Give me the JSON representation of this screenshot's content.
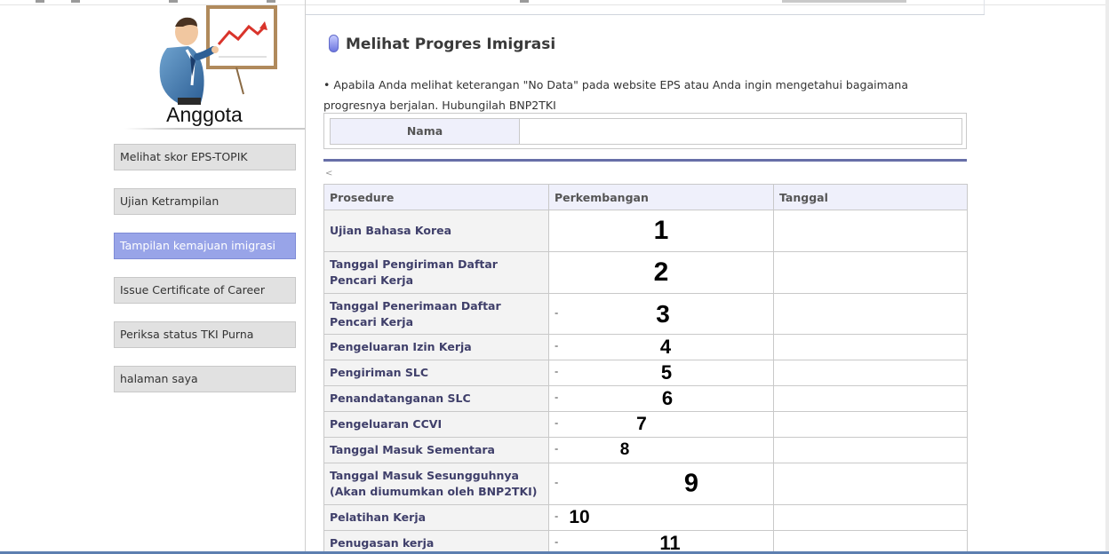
{
  "sidebar": {
    "title": "Anggota",
    "items": [
      {
        "label": "Melihat skor EPS-TOPIK",
        "active": false
      },
      {
        "label": "Ujian Ketrampilan",
        "active": false
      },
      {
        "label": "Tampilan kemajuan imigrasi",
        "active": true
      },
      {
        "label": "Issue Certificate of Career",
        "active": false
      },
      {
        "label": "Periksa status TKI Purna",
        "active": false
      },
      {
        "label": "halaman saya",
        "active": false
      }
    ]
  },
  "page": {
    "title": "Melihat Progres Imigrasi",
    "note": "• Apabila Anda melihat keterangan \"No Data\" pada website EPS atau Anda ingin mengetahui bagaimana progresnya berjalan. Hubungilah BNP2TKI",
    "name_label": "Nama",
    "small_mark": "<"
  },
  "table": {
    "headers": [
      "Prosedure",
      "Perkembangan",
      "Tanggal"
    ],
    "rows": [
      {
        "procedure": "Ujian Bahasa Korea",
        "dash": "",
        "marker": "1"
      },
      {
        "procedure": "Tanggal Pengiriman Daftar Pencari Kerja",
        "dash": "",
        "marker": "2"
      },
      {
        "procedure": "Tanggal Penerimaan Daftar Pencari Kerja",
        "dash": "-",
        "marker": "3"
      },
      {
        "procedure": "Pengeluaran Izin Kerja",
        "dash": "-",
        "marker": "4"
      },
      {
        "procedure": "Pengiriman SLC",
        "dash": "-",
        "marker": "5"
      },
      {
        "procedure": "Penandatanganan SLC",
        "dash": "-",
        "marker": "6"
      },
      {
        "procedure": "Pengeluaran CCVI",
        "dash": "-",
        "marker": "7"
      },
      {
        "procedure": "Tanggal Masuk Sementara",
        "dash": "-",
        "marker": "8"
      },
      {
        "procedure": "Tanggal Masuk Sesungguhnya (Akan diumumkan oleh BNP2TKI)",
        "dash": "-",
        "marker": "9"
      },
      {
        "procedure": "Pelatihan Kerja",
        "dash": "-",
        "marker": "10"
      },
      {
        "procedure": "Penugasan kerja",
        "dash": "-",
        "marker": "11"
      }
    ]
  },
  "colors": {
    "active_nav": "#98a4e8",
    "header_bg": "#eff0fb",
    "rule_blue": "#676fa8"
  }
}
